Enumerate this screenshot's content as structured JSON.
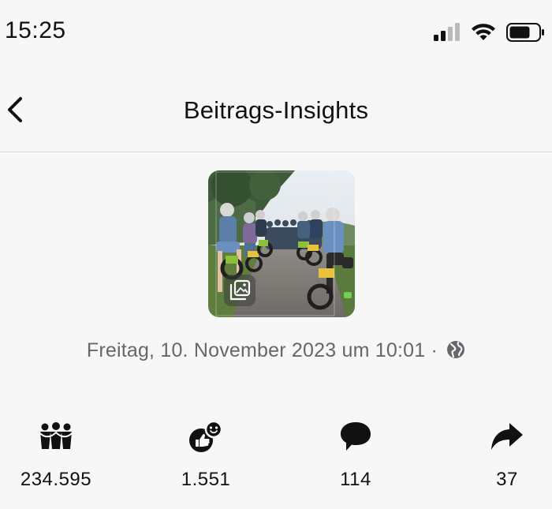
{
  "status_bar": {
    "time": "15:25"
  },
  "header": {
    "title": "Beitrags-Insights"
  },
  "post": {
    "date": "Freitag, 10. November 2023 um 10:01",
    "separator": "·",
    "visibility_icon": "globe-icon",
    "media_badge_icon": "album-icon"
  },
  "metrics": [
    {
      "icon": "people-reach-icon",
      "value": "234.595"
    },
    {
      "icon": "reactions-icon",
      "value": "1.551"
    },
    {
      "icon": "comment-icon",
      "value": "114"
    },
    {
      "icon": "share-icon",
      "value": "37"
    }
  ],
  "colors": {
    "background": "#f7f7f7",
    "text_primary": "#111111",
    "text_secondary": "#65676b",
    "divider": "#dadada"
  }
}
